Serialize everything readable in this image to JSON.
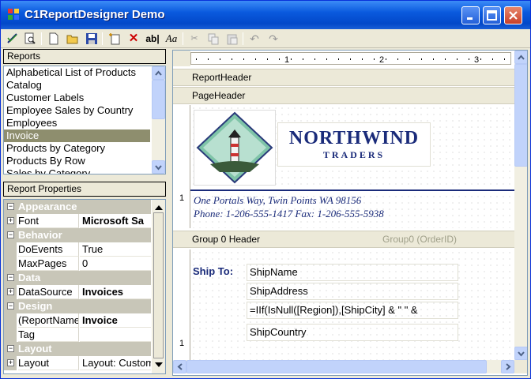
{
  "window": {
    "title": "C1ReportDesigner Demo"
  },
  "toolbar": {
    "icons": [
      "design-icon",
      "preview-icon",
      "new-icon",
      "open-icon",
      "save-icon",
      "new-report-icon",
      "delete-icon",
      "text-field-icon",
      "font-icon",
      "cut-icon",
      "copy-icon",
      "paste-icon",
      "undo-icon",
      "redo-icon"
    ]
  },
  "reports": {
    "header": "Reports",
    "items": [
      "Alphabetical List of Products",
      "Catalog",
      "Customer Labels",
      "Employee Sales by Country",
      "Employees",
      "Invoice",
      "Products by Category",
      "Products By Row",
      "Sales by Category"
    ],
    "selected": "Invoice"
  },
  "properties": {
    "header": "Report Properties",
    "rows": [
      {
        "type": "cat",
        "name": "Appearance"
      },
      {
        "type": "prop",
        "name": "Font",
        "value": "Microsoft Sa",
        "bold": true,
        "expand": true
      },
      {
        "type": "cat",
        "name": "Behavior"
      },
      {
        "type": "prop",
        "name": "DoEvents",
        "value": "True"
      },
      {
        "type": "prop",
        "name": "MaxPages",
        "value": "0"
      },
      {
        "type": "cat",
        "name": "Data"
      },
      {
        "type": "prop",
        "name": "DataSource",
        "value": "Invoices",
        "bold": true,
        "expand": true
      },
      {
        "type": "cat",
        "name": "Design"
      },
      {
        "type": "prop",
        "name": "(ReportName",
        "value": "Invoice",
        "bold": true
      },
      {
        "type": "prop",
        "name": "Tag",
        "value": ""
      },
      {
        "type": "cat",
        "name": "Layout"
      },
      {
        "type": "prop",
        "name": "Layout",
        "value": "Layout: Custom",
        "expand": true
      }
    ]
  },
  "designer": {
    "ruler_marks": [
      "1",
      "2",
      "3"
    ],
    "bands": {
      "report_header": "ReportHeader",
      "page_header": "PageHeader",
      "group_header": "Group 0 Header",
      "group_header_expr": "Group0 (OrderID)"
    },
    "logo": {
      "line1": "NORTHWIND",
      "line2": "TRADERS"
    },
    "address_line": "One Portals Way, Twin Points WA 98156",
    "phone_line": "Phone: 1-206-555-1417  Fax: 1-206-555-5938",
    "ship_to_label": "Ship To:",
    "fields": [
      "ShipName",
      "ShipAddress",
      "=IIf(IsNull([Region]),[ShipCity] & \"  \" &",
      "ShipCountry"
    ],
    "vruler_mark": "1",
    "vruler_mark2": "1"
  },
  "colors": {
    "title_bar": "#0a5ade",
    "selection": "#8e8e6e",
    "navy_text": "#1a2b7a"
  }
}
